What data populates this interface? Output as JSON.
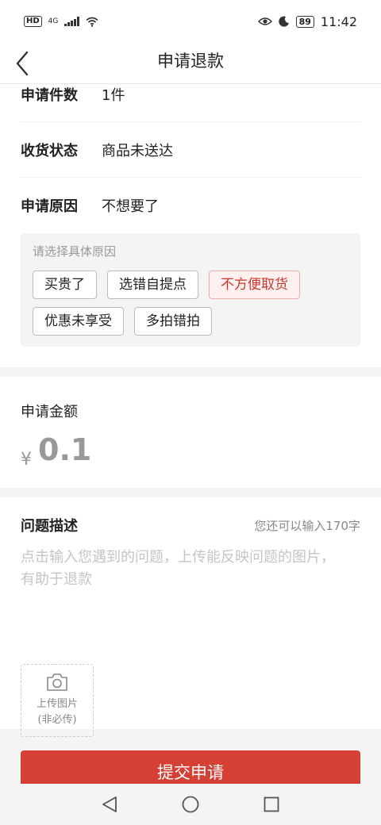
{
  "status_bar": {
    "hd": "HD",
    "network": "4G",
    "battery": "89",
    "time": "11:42"
  },
  "nav": {
    "title": "申请退款"
  },
  "info": {
    "quantity_label": "申请件数",
    "quantity_value": "1件",
    "status_label": "收货状态",
    "status_value": "商品未送达",
    "reason_label": "申请原因",
    "reason_value": "不想要了"
  },
  "reasons": {
    "hint": "请选择具体原因",
    "tags": [
      "买贵了",
      "选错自提点",
      "不方便取货",
      "优惠未享受",
      "多拍错拍"
    ],
    "selected_index": 2,
    "selected_color": "#c9382e"
  },
  "amount": {
    "title": "申请金额",
    "currency": "¥",
    "value": "0.1"
  },
  "description": {
    "title": "问题描述",
    "remaining": "您还可以输入170字",
    "placeholder": "点击输入您遇到的问题，上传能反映问题的图片，有助于退款",
    "value": ""
  },
  "upload": {
    "label_line1": "上传图片",
    "label_line2": "(非必传)",
    "icon": "camera-icon"
  },
  "submit": {
    "label": "提交申请",
    "color": "#d63f33"
  },
  "system_nav": {
    "icons": [
      "back-triangle-icon",
      "home-circle-icon",
      "recents-square-icon"
    ]
  }
}
